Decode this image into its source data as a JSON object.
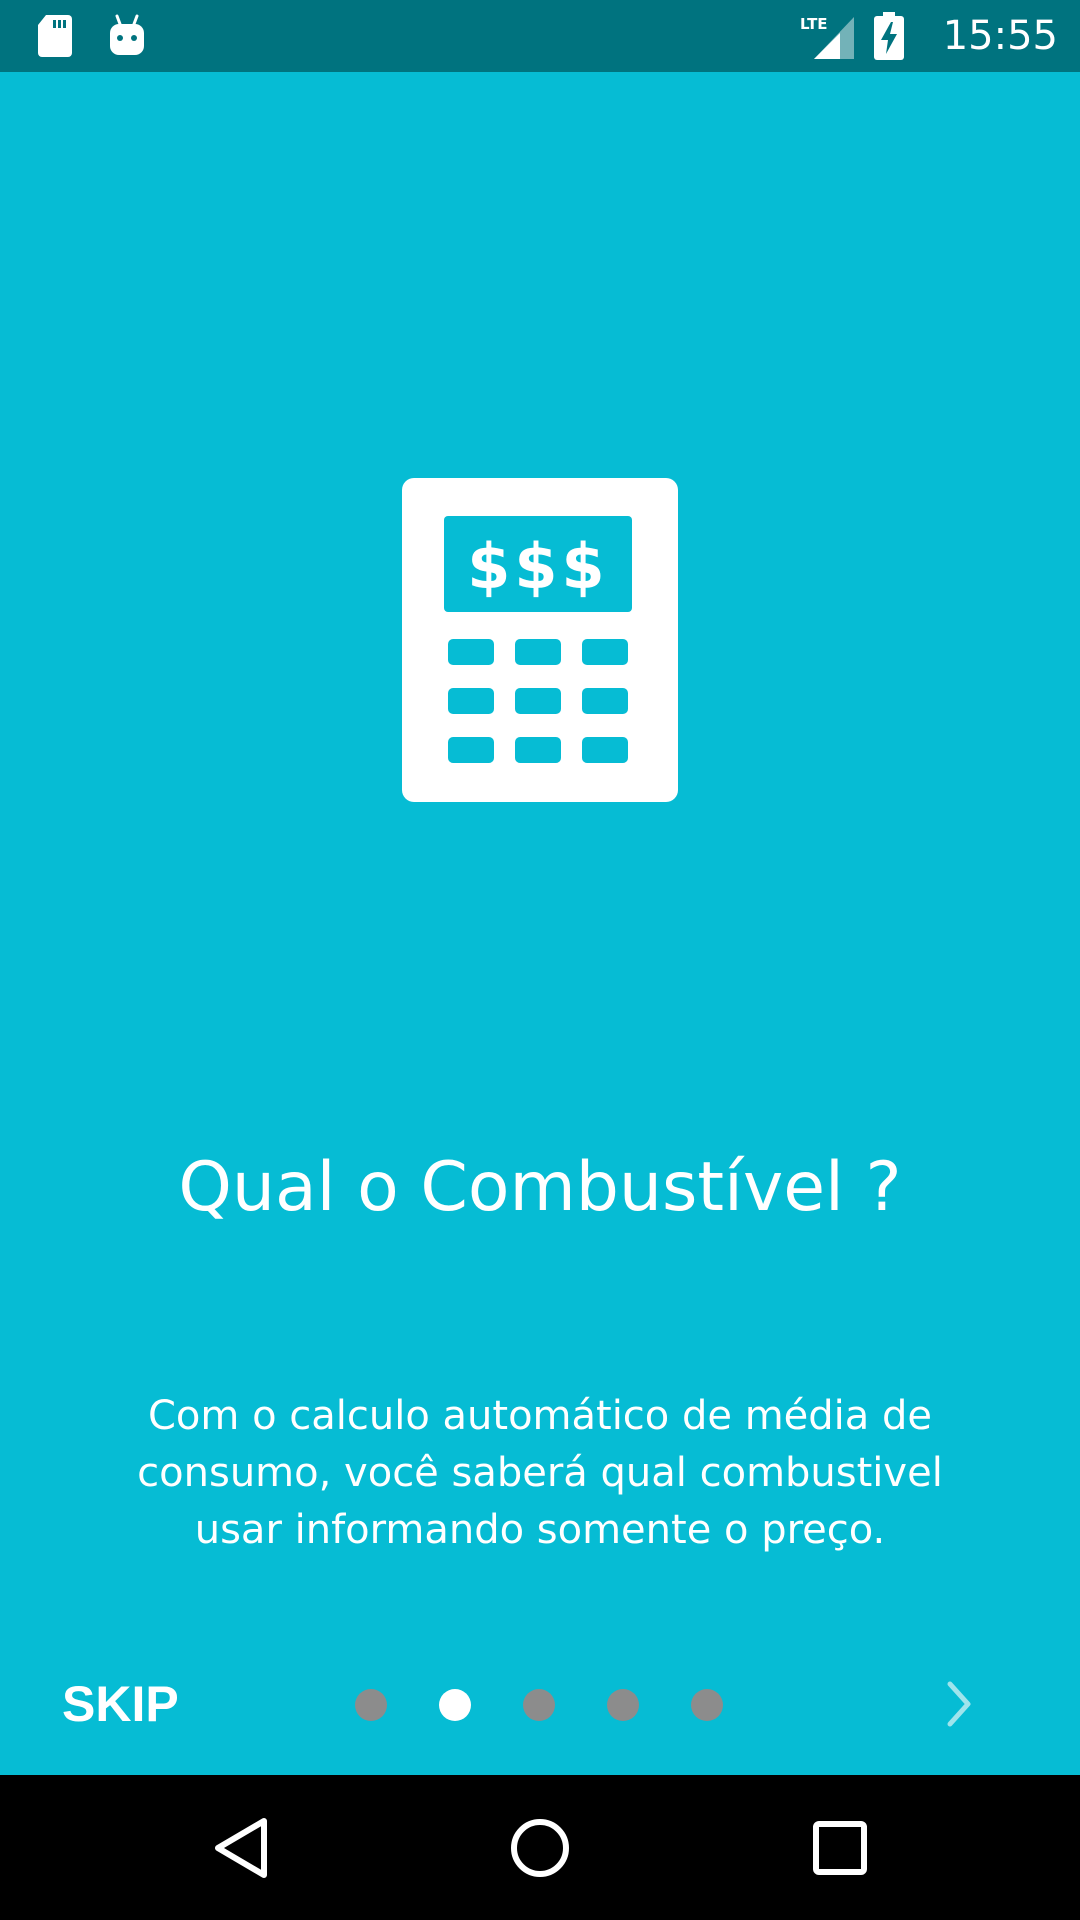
{
  "status_bar": {
    "time": "15:55",
    "network": "LTE",
    "icons": [
      "sd-card-icon",
      "android-debug-icon",
      "lte-signal-icon",
      "battery-charging-icon"
    ]
  },
  "onboarding": {
    "hero_icon": "calculator-money-icon",
    "hero_text": "$$$",
    "title": "Qual o Combustível ?",
    "description": "Com o calculo automático de média de consumo, você saberá qual combustivel usar informando somente o preço.",
    "skip_label": "SKIP",
    "page_count": 5,
    "current_page": 2,
    "next_icon": "chevron-right-icon"
  },
  "nav_bar": {
    "buttons": [
      "back-icon",
      "home-icon",
      "recents-icon"
    ]
  },
  "colors": {
    "background": "#06bcd4",
    "status_bar": "#00737f",
    "nav_bar": "#000000",
    "text": "#ffffff",
    "dot_inactive": "#8c8c8c",
    "dot_active": "#ffffff"
  }
}
